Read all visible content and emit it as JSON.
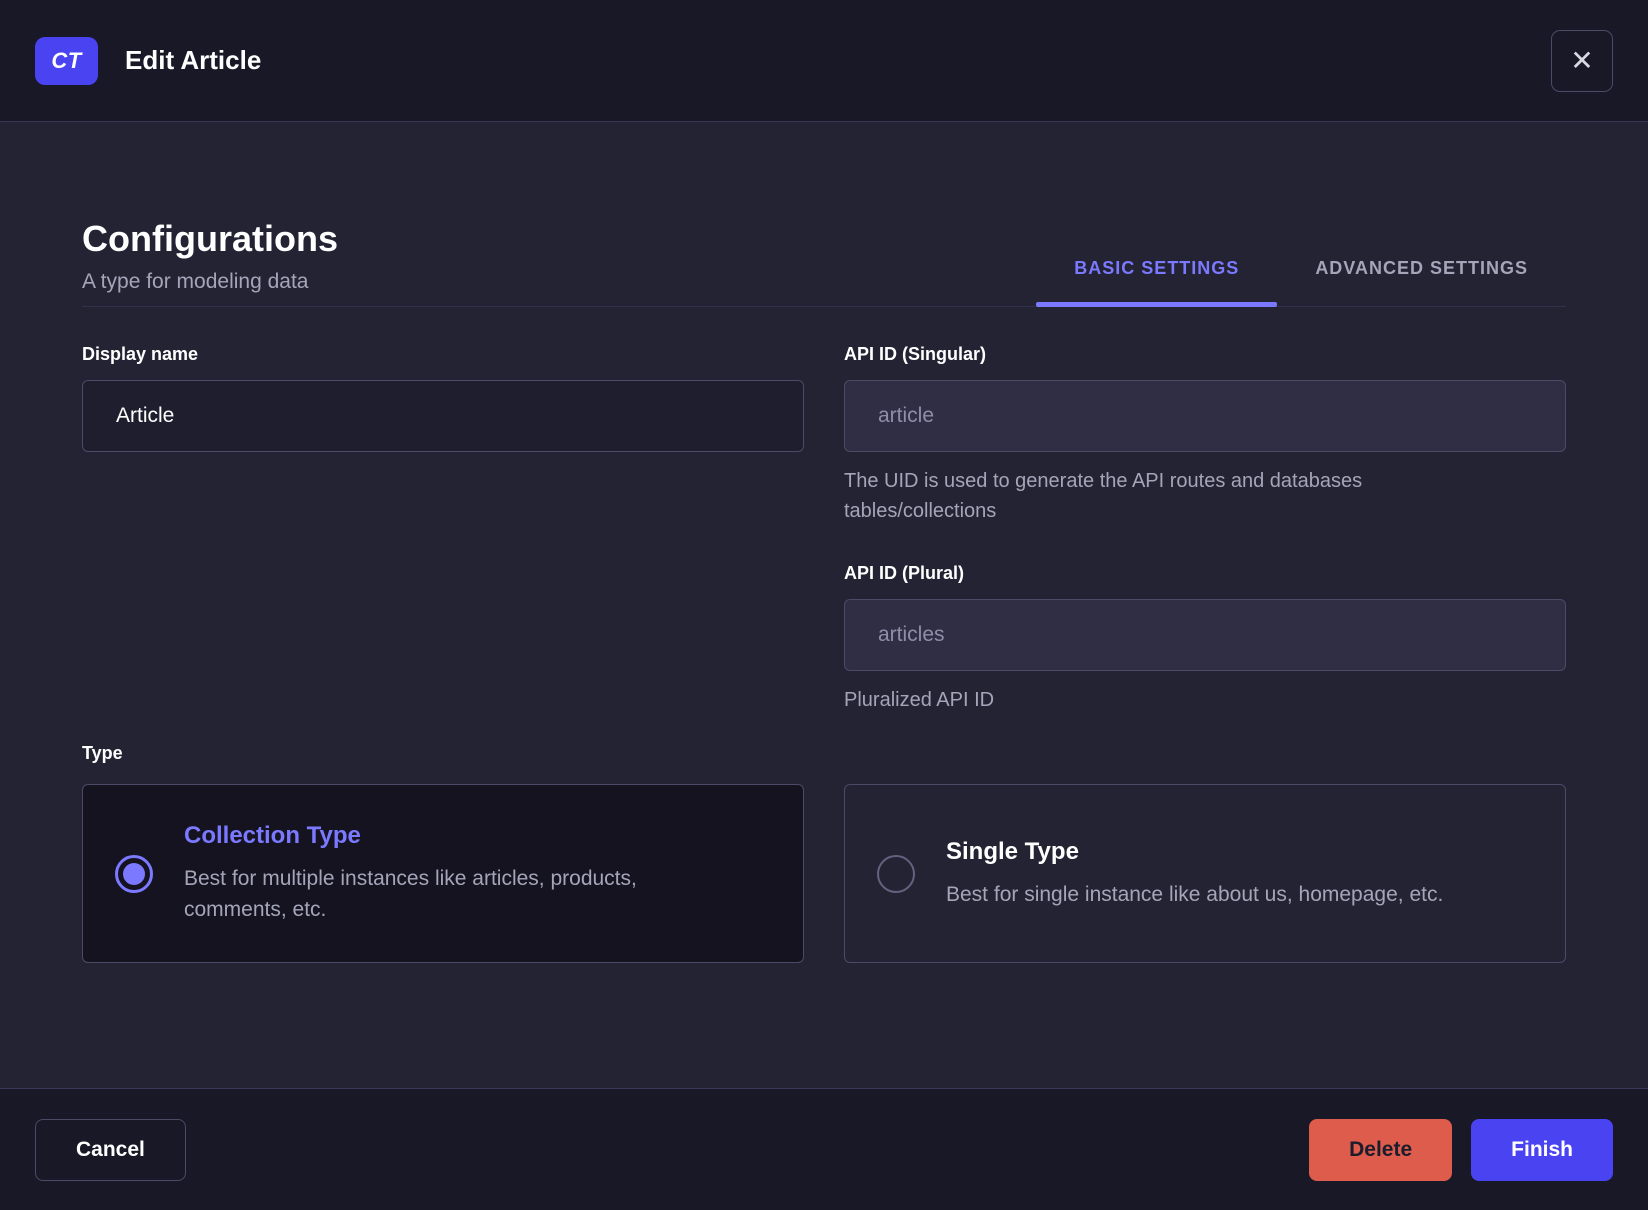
{
  "header": {
    "badge_label": "CT",
    "title": "Edit Article",
    "close_icon": "✕"
  },
  "configurations": {
    "title": "Configurations",
    "subtitle": "A type for modeling data",
    "tabs": [
      {
        "label": "BASIC SETTINGS",
        "active": true
      },
      {
        "label": "ADVANCED SETTINGS",
        "active": false
      }
    ]
  },
  "form": {
    "display_name": {
      "label": "Display name",
      "value": "Article"
    },
    "api_id_singular": {
      "label": "API ID (Singular)",
      "value": "article",
      "helper": "The UID is used to generate the API routes and databases tables/collections"
    },
    "api_id_plural": {
      "label": "API ID (Plural)",
      "value": "articles",
      "helper": "Pluralized API ID"
    },
    "type": {
      "label": "Type",
      "options": [
        {
          "title": "Collection Type",
          "description": "Best for multiple instances like articles, products, comments, etc.",
          "selected": true
        },
        {
          "title": "Single Type",
          "description": "Best for single instance like about us, homepage, etc.",
          "selected": false
        }
      ]
    }
  },
  "footer": {
    "cancel_label": "Cancel",
    "delete_label": "Delete",
    "finish_label": "Finish"
  },
  "colors": {
    "accent": "#4a43f2",
    "accent_text": "#7b79ff",
    "danger": "#de5c4c",
    "text_muted": "#a5a5ba",
    "surface_dark": "#181826",
    "surface_body": "#232334"
  }
}
